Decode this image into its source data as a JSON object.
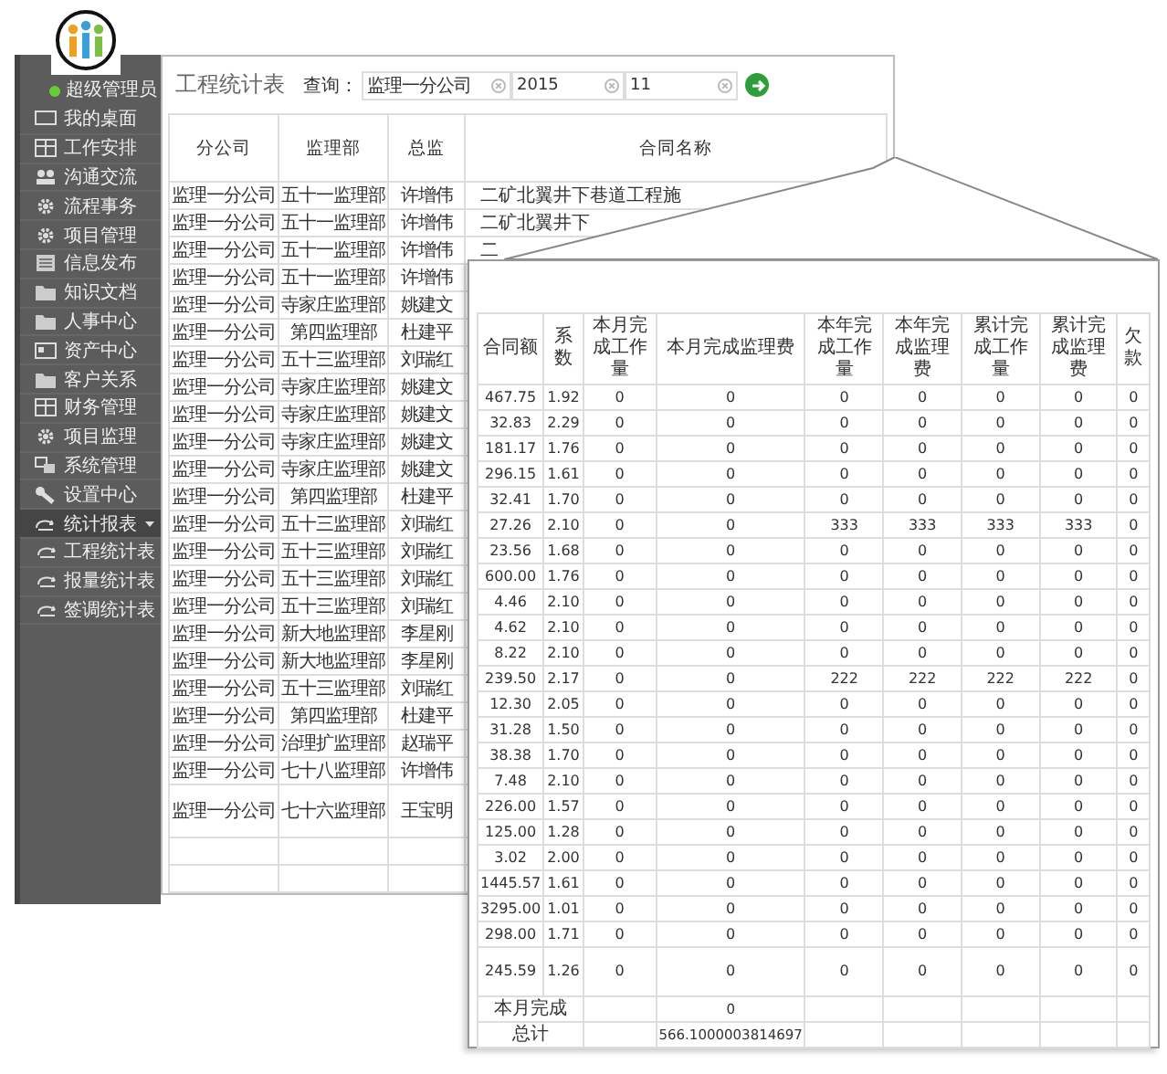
{
  "sidebar": {
    "user": "超级管理员",
    "items": [
      {
        "label": "我的桌面"
      },
      {
        "label": "工作安排"
      },
      {
        "label": "沟通交流"
      },
      {
        "label": "流程事务"
      },
      {
        "label": "项目管理"
      },
      {
        "label": "信息发布"
      },
      {
        "label": "知识文档"
      },
      {
        "label": "人事中心"
      },
      {
        "label": "资产中心"
      },
      {
        "label": "客户关系"
      },
      {
        "label": "财务管理"
      },
      {
        "label": "项目监理"
      },
      {
        "label": "系统管理"
      },
      {
        "label": "设置中心"
      },
      {
        "label": "统计报表",
        "expanded": true,
        "children": [
          {
            "label": "工程统计表"
          },
          {
            "label": "报量统计表"
          },
          {
            "label": "签调统计表"
          }
        ]
      }
    ]
  },
  "report": {
    "title": "工程统计表",
    "query_label": "查询：",
    "filters": [
      {
        "value": "监理一分公司"
      },
      {
        "value": "2015"
      },
      {
        "value": "11"
      }
    ],
    "table": {
      "columns": [
        "分公司",
        "监理部",
        "总监",
        "合同名称"
      ],
      "rows": [
        [
          "监理一分公司",
          "五十一监理部",
          "许增伟",
          "二矿北翼井下巷道工程施"
        ],
        [
          "监理一分公司",
          "五十一监理部",
          "许增伟",
          "二矿北翼井下"
        ],
        [
          "监理一分公司",
          "五十一监理部",
          "许增伟",
          "二"
        ],
        [
          "监理一分公司",
          "五十一监理部",
          "许增伟",
          ""
        ],
        [
          "监理一分公司",
          "寺家庄监理部",
          "姚建文",
          ""
        ],
        [
          "监理一分公司",
          "第四监理部",
          "杜建平",
          ""
        ],
        [
          "监理一分公司",
          "五十三监理部",
          "刘瑞红",
          ""
        ],
        [
          "监理一分公司",
          "寺家庄监理部",
          "姚建文",
          ""
        ],
        [
          "监理一分公司",
          "寺家庄监理部",
          "姚建文",
          ""
        ],
        [
          "监理一分公司",
          "寺家庄监理部",
          "姚建文",
          ""
        ],
        [
          "监理一分公司",
          "寺家庄监理部",
          "姚建文",
          ""
        ],
        [
          "监理一分公司",
          "第四监理部",
          "杜建平",
          ""
        ],
        [
          "监理一分公司",
          "五十三监理部",
          "刘瑞红",
          ""
        ],
        [
          "监理一分公司",
          "五十三监理部",
          "刘瑞红",
          ""
        ],
        [
          "监理一分公司",
          "五十三监理部",
          "刘瑞红",
          ""
        ],
        [
          "监理一分公司",
          "五十三监理部",
          "刘瑞红",
          ""
        ],
        [
          "监理一分公司",
          "新大地监理部",
          "李星刚",
          ""
        ],
        [
          "监理一分公司",
          "新大地监理部",
          "李星刚",
          ""
        ],
        [
          "监理一分公司",
          "五十三监理部",
          "刘瑞红",
          ""
        ],
        [
          "监理一分公司",
          "第四监理部",
          "杜建平",
          ""
        ],
        [
          "监理一分公司",
          "治理扩监理部",
          "赵瑞平",
          ""
        ],
        [
          "监理一分公司",
          "七十八监理部",
          "许增伟",
          ""
        ],
        [
          "监理一分公司",
          "七十六监理部",
          "王宝明",
          ""
        ]
      ]
    }
  },
  "detail": {
    "table": {
      "columns": [
        "合同额",
        "系数",
        "本月完成工作量",
        "本月完成监理费",
        "本年完成工作量",
        "本年完成监理费",
        "累计完成工作量",
        "累计完成监理费",
        "欠款"
      ],
      "rows": [
        [
          "467.75",
          "1.92",
          "0",
          "0",
          "0",
          "0",
          "0",
          "0",
          "0"
        ],
        [
          "32.83",
          "2.29",
          "0",
          "0",
          "0",
          "0",
          "0",
          "0",
          "0"
        ],
        [
          "181.17",
          "1.76",
          "0",
          "0",
          "0",
          "0",
          "0",
          "0",
          "0"
        ],
        [
          "296.15",
          "1.61",
          "0",
          "0",
          "0",
          "0",
          "0",
          "0",
          "0"
        ],
        [
          "32.41",
          "1.70",
          "0",
          "0",
          "0",
          "0",
          "0",
          "0",
          "0"
        ],
        [
          "27.26",
          "2.10",
          "0",
          "0",
          "333",
          "333",
          "333",
          "333",
          "0"
        ],
        [
          "23.56",
          "1.68",
          "0",
          "0",
          "0",
          "0",
          "0",
          "0",
          "0"
        ],
        [
          "600.00",
          "1.76",
          "0",
          "0",
          "0",
          "0",
          "0",
          "0",
          "0"
        ],
        [
          "4.46",
          "2.10",
          "0",
          "0",
          "0",
          "0",
          "0",
          "0",
          "0"
        ],
        [
          "4.62",
          "2.10",
          "0",
          "0",
          "0",
          "0",
          "0",
          "0",
          "0"
        ],
        [
          "8.22",
          "2.10",
          "0",
          "0",
          "0",
          "0",
          "0",
          "0",
          "0"
        ],
        [
          "239.50",
          "2.17",
          "0",
          "0",
          "222",
          "222",
          "222",
          "222",
          "0"
        ],
        [
          "12.30",
          "2.05",
          "0",
          "0",
          "0",
          "0",
          "0",
          "0",
          "0"
        ],
        [
          "31.28",
          "1.50",
          "0",
          "0",
          "0",
          "0",
          "0",
          "0",
          "0"
        ],
        [
          "38.38",
          "1.70",
          "0",
          "0",
          "0",
          "0",
          "0",
          "0",
          "0"
        ],
        [
          "7.48",
          "2.10",
          "0",
          "0",
          "0",
          "0",
          "0",
          "0",
          "0"
        ],
        [
          "226.00",
          "1.57",
          "0",
          "0",
          "0",
          "0",
          "0",
          "0",
          "0"
        ],
        [
          "125.00",
          "1.28",
          "0",
          "0",
          "0",
          "0",
          "0",
          "0",
          "0"
        ],
        [
          "3.02",
          "2.00",
          "0",
          "0",
          "0",
          "0",
          "0",
          "0",
          "0"
        ],
        [
          "1445.57",
          "1.61",
          "0",
          "0",
          "0",
          "0",
          "0",
          "0",
          "0"
        ],
        [
          "3295.00",
          "1.01",
          "0",
          "0",
          "0",
          "0",
          "0",
          "0",
          "0"
        ],
        [
          "298.00",
          "1.71",
          "0",
          "0",
          "0",
          "0",
          "0",
          "0",
          "0"
        ],
        [
          "245.59",
          "1.26",
          "0",
          "0",
          "0",
          "0",
          "0",
          "0",
          "0"
        ]
      ],
      "footer": [
        {
          "label": "本月完成",
          "value": "0"
        },
        {
          "label": "总计",
          "value": "566.1000003814697"
        }
      ]
    }
  }
}
